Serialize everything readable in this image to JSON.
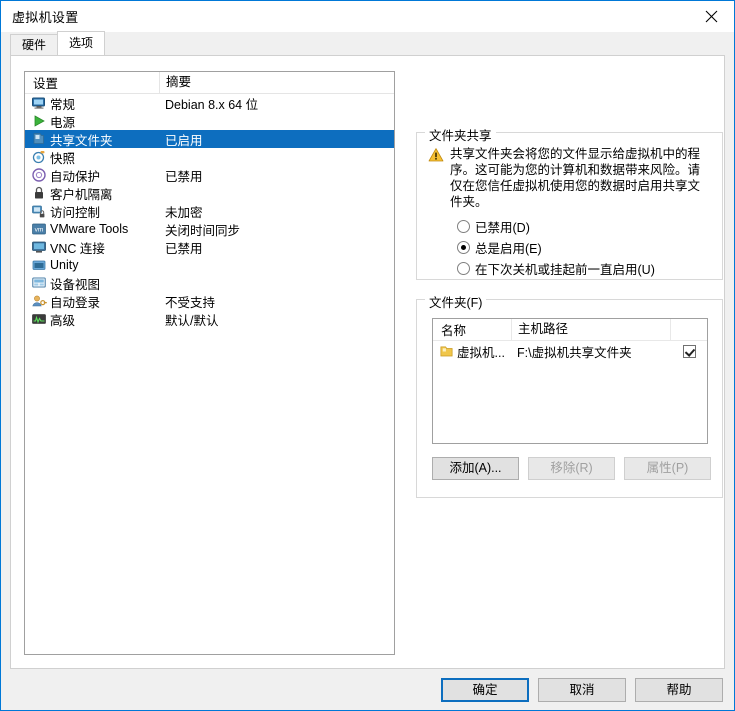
{
  "window": {
    "title": "虚拟机设置",
    "close_icon": "close-icon"
  },
  "tabs": [
    {
      "label": "硬件",
      "active": false
    },
    {
      "label": "选项",
      "active": true
    }
  ],
  "settings_list": {
    "headers": {
      "name": "设置",
      "summary": "摘要"
    },
    "rows": [
      {
        "icon": "monitor-icon",
        "label": "常规",
        "summary": "Debian 8.x 64 位",
        "selected": false
      },
      {
        "icon": "play-triangle-icon",
        "label": "电源",
        "summary": "",
        "selected": false
      },
      {
        "icon": "folder-icon",
        "label": "共享文件夹",
        "summary": "已启用",
        "selected": true
      },
      {
        "icon": "camera-icon",
        "label": "快照",
        "summary": "",
        "selected": false
      },
      {
        "icon": "autoprotect-icon",
        "label": "自动保护",
        "summary": "已禁用",
        "selected": false
      },
      {
        "icon": "lock-icon",
        "label": "客户机隔离",
        "summary": "",
        "selected": false
      },
      {
        "icon": "access-control-icon",
        "label": "访问控制",
        "summary": "未加密",
        "selected": false
      },
      {
        "icon": "vmware-tools-icon",
        "label": "VMware Tools",
        "summary": "关闭时间同步",
        "selected": false
      },
      {
        "icon": "vnc-icon",
        "label": "VNC 连接",
        "summary": "已禁用",
        "selected": false
      },
      {
        "icon": "unity-icon",
        "label": "Unity",
        "summary": "",
        "selected": false
      },
      {
        "icon": "device-view-icon",
        "label": "设备视图",
        "summary": "",
        "selected": false
      },
      {
        "icon": "auto-login-icon",
        "label": "自动登录",
        "summary": "不受支持",
        "selected": false
      },
      {
        "icon": "advanced-icon",
        "label": "高级",
        "summary": "默认/默认",
        "selected": false
      }
    ]
  },
  "sharing": {
    "group_title": "文件夹共享",
    "warning_icon": "warning-triangle-icon",
    "warning_text": "共享文件夹会将您的文件显示给虚拟机中的程序。这可能为您的计算机和数据带来风险。请仅在您信任虚拟机使用您的数据时启用共享文件夹。",
    "options": [
      {
        "label": "已禁用(D)",
        "checked": false
      },
      {
        "label": "总是启用(E)",
        "checked": true
      },
      {
        "label": "在下次关机或挂起前一直启用(U)",
        "checked": false
      }
    ]
  },
  "folders": {
    "group_title": "文件夹(F)",
    "headers": {
      "name": "名称",
      "host_path": "主机路径"
    },
    "rows": [
      {
        "icon": "folder-icon",
        "name": "虚拟机...",
        "host_path": "F:\\虚拟机共享文件夹",
        "enabled": true
      }
    ],
    "buttons": [
      {
        "label": "添加(A)...",
        "enabled": true
      },
      {
        "label": "移除(R)",
        "enabled": false
      },
      {
        "label": "属性(P)",
        "enabled": false
      }
    ]
  },
  "dialog_buttons": [
    {
      "label": "确定",
      "default": true
    },
    {
      "label": "取消",
      "default": false
    },
    {
      "label": "帮助",
      "default": false
    }
  ],
  "colors": {
    "selection_blue": "#0d6ebf",
    "window_border": "#0078d7",
    "warning_yellow": "#f5c034"
  }
}
